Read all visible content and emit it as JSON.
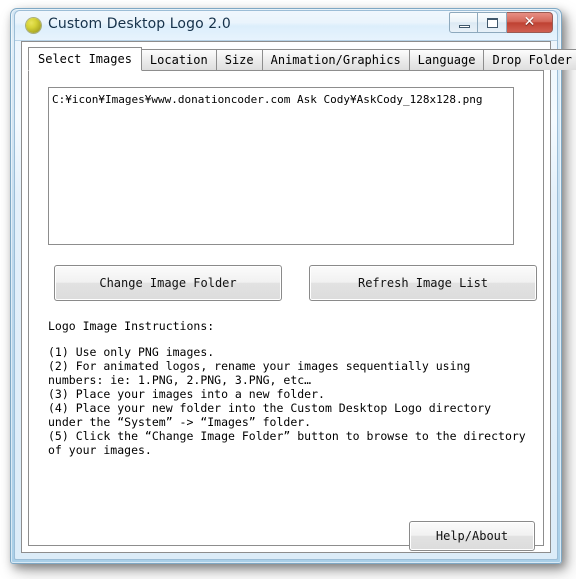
{
  "window": {
    "title": "Custom Desktop Logo 2.0",
    "icon": "yellow-circle-logo-icon",
    "caption_buttons": {
      "minimize_label": "–",
      "maximize_label": "□",
      "close_label": "✕"
    },
    "accent_colors": {
      "frame": "#a9cfe8",
      "titlebar": "#eaf4fc",
      "close_button": "#bf4233",
      "logo_icon": "#d5d236",
      "client_background": "#ffffff",
      "border": "#8d8d8d"
    }
  },
  "tabs": [
    {
      "label": "Select Images",
      "active": true
    },
    {
      "label": "Location",
      "active": false
    },
    {
      "label": "Size",
      "active": false
    },
    {
      "label": "Animation/Graphics",
      "active": false
    },
    {
      "label": "Language",
      "active": false
    },
    {
      "label": "Drop Folder",
      "active": false
    }
  ],
  "image_list": {
    "items": [
      "C:¥icon¥Images¥www.donationcoder.com Ask Cody¥AskCody_128x128.png"
    ]
  },
  "buttons": {
    "change_image_folder": "Change Image Folder",
    "refresh_image_list": "Refresh Image List",
    "help_about": "Help/About"
  },
  "instructions": {
    "title": "Logo Image Instructions:",
    "lines": [
      "(1) Use only PNG images.",
      "(2) For animated logos, rename your images sequentially using numbers: ie: 1.PNG, 2.PNG, 3.PNG, etc…",
      "(3) Place your images into a new folder.",
      "(4) Place your new folder into the Custom Desktop Logo directory under the “System” -> “Images” folder.",
      "(5) Click the “Change Image Folder” button to browse to the directory of your images."
    ]
  }
}
